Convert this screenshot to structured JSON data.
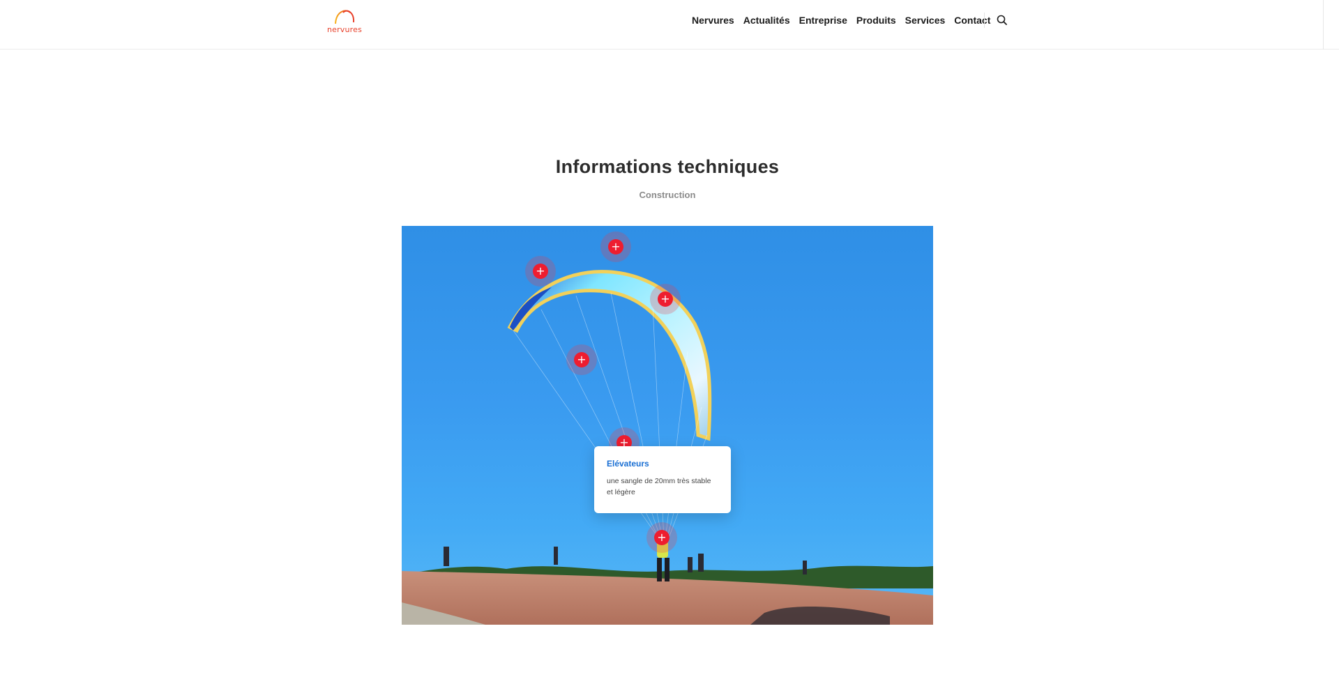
{
  "header": {
    "logo_text": "nervures",
    "nav": [
      "Nervures",
      "Actualités",
      "Entreprise",
      "Produits",
      "Services",
      "Contact"
    ],
    "search_icon": "search-icon"
  },
  "main": {
    "title": "Informations techniques",
    "subtitle": "Construction"
  },
  "tooltip": {
    "title": "Elévateurs",
    "body": "une sangle de 20mm très stable et légère"
  },
  "hotspots": {
    "symbol": "+",
    "count": 6
  },
  "colors": {
    "accent": "#ee1d2f",
    "link_blue": "#1a6fd3",
    "logo": "#e8402a"
  }
}
